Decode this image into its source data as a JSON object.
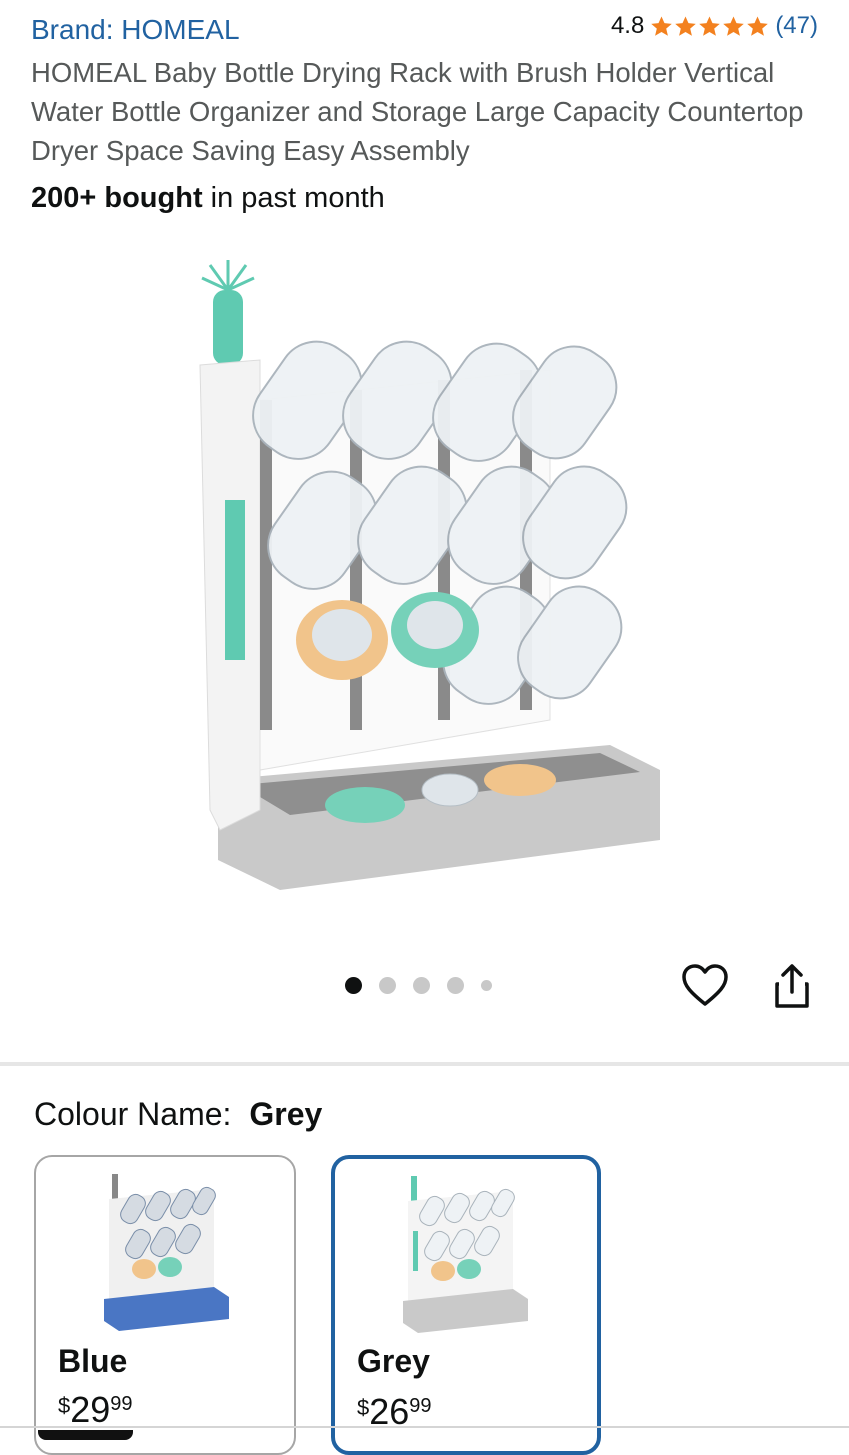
{
  "product": {
    "brand_link": "Brand: HOMEAL",
    "rating": "4.8",
    "rating_count": "(47)",
    "title": "HOMEAL Baby Bottle Drying Rack with Brush Holder Vertical Water Bottle Organizer and Storage Large Capacity Countertop Dryer Space Saving Easy Assembly",
    "bought_bold": "200+ bought",
    "bought_rest": " in past month",
    "star_color": "#f3811f"
  },
  "gallery": {
    "image_count": 5,
    "active_index": 0
  },
  "variations": {
    "label": "Colour Name:",
    "selected_value": "Grey",
    "options": [
      {
        "name": "Blue",
        "currency": "$",
        "price_whole": "29",
        "price_fraction": "99",
        "tray_color": "#4a76c4"
      },
      {
        "name": "Grey",
        "currency": "$",
        "price_whole": "26",
        "price_fraction": "99",
        "tray_color": "#c9c9c9"
      }
    ]
  },
  "colors": {
    "link": "#2162a1",
    "selected_border": "#2162a1"
  }
}
